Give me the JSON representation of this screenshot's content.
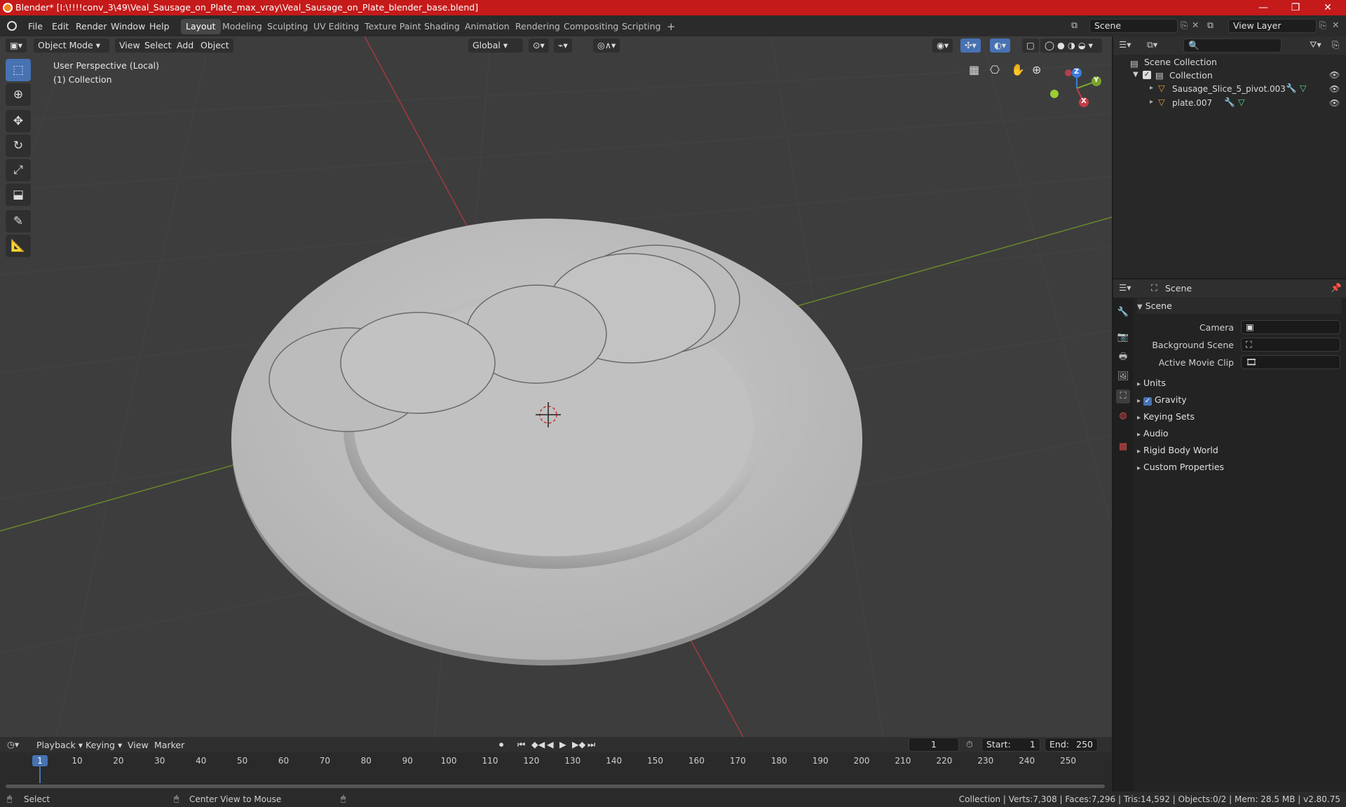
{
  "title": "Blender* [I:\\!!!!conv_3\\49\\Veal_Sausage_on_Plate_max_vray\\Veal_Sausage_on_Plate_blender_base.blend]",
  "menu": [
    "File",
    "Edit",
    "Render",
    "Window",
    "Help"
  ],
  "workspaces": [
    "Layout",
    "Modeling",
    "Sculpting",
    "UV Editing",
    "Texture Paint",
    "Shading",
    "Animation",
    "Rendering",
    "Compositing",
    "Scripting"
  ],
  "active_workspace": "Layout",
  "scene_field": "Scene",
  "view_layer_field": "View Layer",
  "viewport": {
    "mode": "Object Mode",
    "menus": [
      "View",
      "Select",
      "Add",
      "Object"
    ],
    "orientation": "Global",
    "info_line1": "User Perspective (Local)",
    "info_line2": "(1) Collection",
    "gizmo": {
      "x": "X",
      "y": "Y",
      "z": "Z"
    }
  },
  "outliner": {
    "root": "Scene Collection",
    "collection": "Collection",
    "items": [
      "Sausage_Slice_5_pivot.003",
      "plate.007"
    ]
  },
  "properties": {
    "header": "Scene",
    "section": "Scene",
    "fields": [
      {
        "label": "Camera"
      },
      {
        "label": "Background Scene"
      },
      {
        "label": "Active Movie Clip"
      }
    ],
    "panels": [
      "Units",
      "Gravity",
      "Keying Sets",
      "Audio",
      "Rigid Body World",
      "Custom Properties"
    ]
  },
  "timeline": {
    "menus": [
      "Playback",
      "Keying",
      "View",
      "Marker"
    ],
    "current_frame": "1",
    "start_label": "Start:",
    "start": "1",
    "end_label": "End:",
    "end": "250",
    "ticks": [
      "1",
      "10",
      "20",
      "30",
      "40",
      "50",
      "60",
      "70",
      "80",
      "90",
      "100",
      "110",
      "120",
      "130",
      "140",
      "150",
      "160",
      "170",
      "180",
      "190",
      "200",
      "210",
      "220",
      "230",
      "240",
      "250"
    ]
  },
  "status": {
    "left": "Select",
    "middle": "Center View to Mouse",
    "right": "Collection | Verts:7,308 | Faces:7,296 | Tris:14,592 | Objects:0/2 | Mem: 28.5 MB | v2.80.75"
  },
  "colors": {
    "titlebar": "#c41a1a",
    "accent": "#4772b3",
    "x_axis": "#c73b45",
    "y_axis": "#7ba32c",
    "z_axis": "#3b7de0"
  }
}
